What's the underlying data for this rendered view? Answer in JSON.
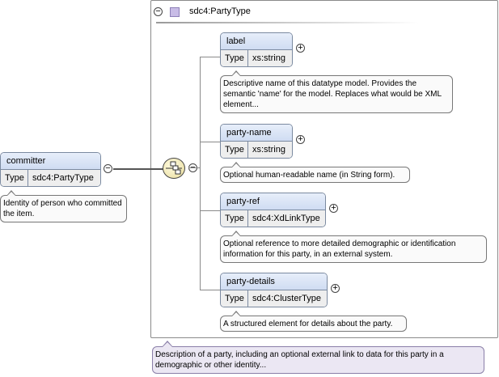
{
  "complex_type": {
    "name": "sdc4:PartyType"
  },
  "root_element": {
    "name": "committer",
    "type_key": "Type",
    "type_value": "sdc4:PartyType",
    "doc": "Identity of person who committed the item."
  },
  "children": [
    {
      "name": "label",
      "type_key": "Type",
      "type_value": "xs:string",
      "doc": "Descriptive name of this datatype model. Provides the semantic 'name' for the model. Replaces what would be XML element..."
    },
    {
      "name": "party-name",
      "type_key": "Type",
      "type_value": "xs:string",
      "doc": "Optional human-readable name (in String form)."
    },
    {
      "name": "party-ref",
      "type_key": "Type",
      "type_value": "sdc4:XdLinkType",
      "doc": "Optional reference to more detailed demographic or identification information for this party, in an external system."
    },
    {
      "name": "party-details",
      "type_key": "Type",
      "type_value": "sdc4:ClusterType",
      "doc": "A structured element for details about the party."
    }
  ],
  "type_doc": "Description of a party, including an optional external link to data for this party in a demographic or other identity...",
  "symbols": {
    "collapse": "−",
    "expand": "+"
  }
}
